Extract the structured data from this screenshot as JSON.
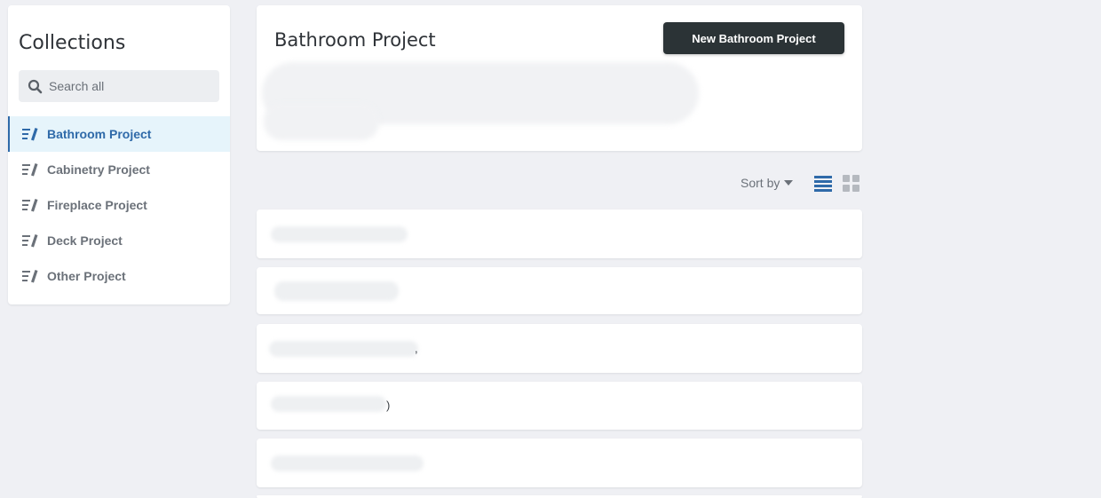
{
  "sidebar": {
    "title": "Collections",
    "search_placeholder": "Search all",
    "items": [
      {
        "label": "Bathroom Project",
        "active": true
      },
      {
        "label": "Cabinetry Project",
        "active": false
      },
      {
        "label": "Fireplace Project",
        "active": false
      },
      {
        "label": "Deck Project",
        "active": false
      },
      {
        "label": "Other Project",
        "active": false
      }
    ]
  },
  "header": {
    "title": "Bathroom Project",
    "new_button_label": "New Bathroom Project"
  },
  "toolbar": {
    "sort_label": "Sort by",
    "active_view": "list"
  },
  "rows": [
    {
      "visible_text": ""
    },
    {
      "visible_text": ""
    },
    {
      "visible_text": ","
    },
    {
      "visible_text": ")"
    },
    {
      "visible_text": ""
    }
  ],
  "icons": {
    "search": "search-icon",
    "collection": "collection-icon",
    "caret": "caret-down-icon",
    "list_view": "list-view-icon",
    "grid_view": "grid-view-icon"
  },
  "colors": {
    "background": "#eff0f4",
    "accent": "#2f6aa9",
    "active_item_bg": "#e6f4fb",
    "button_bg": "#2b3336",
    "muted_text": "#6b7179"
  }
}
